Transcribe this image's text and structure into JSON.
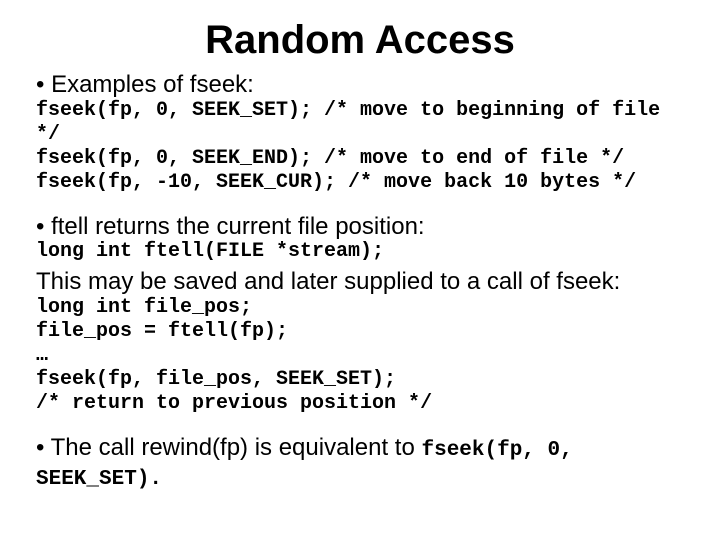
{
  "title": "Random Access",
  "bullets": {
    "b1": "Examples of fseek:",
    "b2": "ftell returns the current file position:",
    "b3_pre": "The call rewind(fp) is equivalent to ",
    "b3_code": "fseek(fp, 0, SEEK_SET)."
  },
  "body": {
    "save_note": "This may be saved and later supplied to a call of fseek:"
  },
  "code": {
    "fseek_examples": "fseek(fp, 0, SEEK_SET); /* move to beginning of file */\nfseek(fp, 0, SEEK_END); /* move to end of file */\nfseek(fp, -10, SEEK_CUR); /* move back 10 bytes */",
    "ftell_sig": "long int ftell(FILE *stream);",
    "save_example": "long int file_pos;\nfile_pos = ftell(fp);\n…\nfseek(fp, file_pos, SEEK_SET);\n/* return to previous position */"
  },
  "bullet_char": "• "
}
